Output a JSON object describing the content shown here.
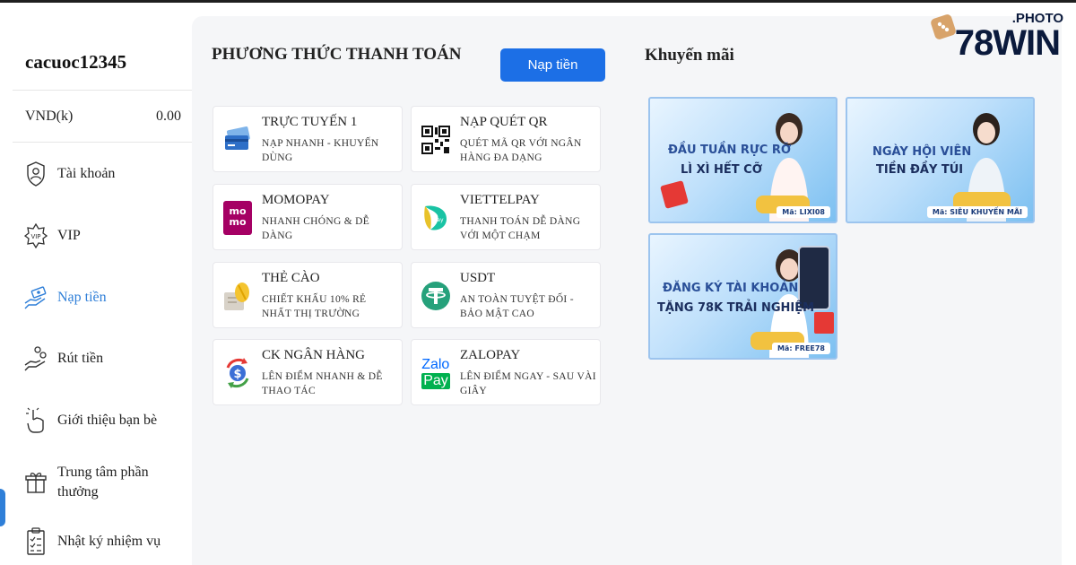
{
  "sidebar": {
    "username": "cacuoc12345",
    "balance_label": "VND(k)",
    "balance_value": "0.00",
    "items": [
      {
        "label": "Tài khoản",
        "icon": "user-shield-icon"
      },
      {
        "label": "VIP",
        "icon": "vip-badge-icon"
      },
      {
        "label": "Nạp tiền",
        "icon": "deposit-hand-icon"
      },
      {
        "label": "Rút tiền",
        "icon": "withdraw-hand-icon"
      },
      {
        "label": "Giới thiệu bạn bè",
        "icon": "refer-friend-icon"
      },
      {
        "label": "Trung tâm phần thưởng",
        "icon": "gift-icon"
      },
      {
        "label": "Nhật ký nhiệm vụ",
        "icon": "clipboard-icon"
      }
    ]
  },
  "payments": {
    "title": "PHƯƠNG THỨC THANH TOÁN",
    "deposit_button": "Nạp tiền",
    "methods": [
      {
        "title": "TRỰC TUYẾN 1",
        "desc": "NẠP NHANH - KHUYẾN DÙNG",
        "icon": "credit-card-icon"
      },
      {
        "title": "NẠP QUÉT QR",
        "desc": "QUÉT MÃ QR VỚI NGÂN HÀNG ĐA DẠNG",
        "icon": "qr-code-icon"
      },
      {
        "title": "MOMOPAY",
        "desc": "NHANH CHÓNG & DỄ DÀNG",
        "icon": "momo-logo-icon"
      },
      {
        "title": "VIETTELPAY",
        "desc": "THANH TOÁN DỄ DÀNG VỚI MỘT CHẠM",
        "icon": "viettelpay-logo-icon"
      },
      {
        "title": "THẺ CÀO",
        "desc": "CHIẾT KHẤU 10% RẺ NHẤT THỊ TRƯỜNG",
        "icon": "scratch-card-icon"
      },
      {
        "title": "USDT",
        "desc": "AN TOÀN TUYỆT ĐỐI - BẢO MẬT CAO",
        "icon": "tether-logo-icon"
      },
      {
        "title": "CK NGÂN HÀNG",
        "desc": "LÊN ĐIỂM NHANH & DỄ THAO TÁC",
        "icon": "bank-transfer-icon"
      },
      {
        "title": "ZALOPAY",
        "desc": "LÊN ĐIỂM NGAY - SAU VÀI GIÂY",
        "icon": "zalopay-logo-icon"
      }
    ],
    "momo_text": "mo\nmo",
    "zalo_text_1": "Zalo",
    "zalo_text_2": "Pay"
  },
  "promotions": {
    "title": "Khuyến mãi",
    "items": [
      {
        "line1": "ĐẦU TUẦN RỰC RỠ",
        "line2": "LÌ XÌ HẾT CỠ",
        "code": "Mã: LIXI08"
      },
      {
        "line1": "NGÀY HỘI VIÊN",
        "line2": "TIỀN ĐẦY TÚI",
        "code": "Mã: SIÊU KHUYẾN MÃI"
      },
      {
        "line1": "ĐĂNG KÝ TÀI KHOẢN",
        "line2": "TẶNG 78K TRẢI NGHIỆM",
        "code": "Mã: FREE78"
      }
    ]
  },
  "logo": {
    "suffix": ".PHOTO",
    "main": "78WIN"
  },
  "colors": {
    "accent": "#1c6fe6",
    "active_nav": "#2f7fd8",
    "brand": "#0b1a3c"
  }
}
